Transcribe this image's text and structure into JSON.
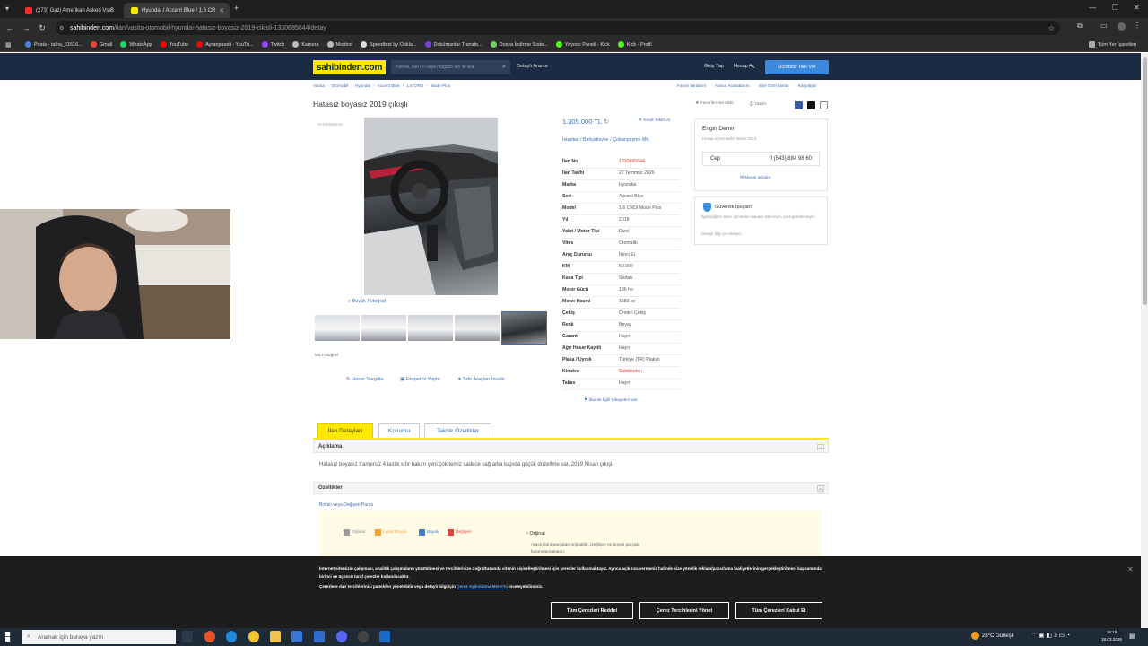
{
  "browser": {
    "tabs": [
      {
        "title": "(273) Gazi Amerikan Askeri Vs B",
        "active": false
      },
      {
        "title": "Hyundai / Accent Blue / 1.6 CR",
        "active": true
      }
    ],
    "url_host": "sahibinden.com",
    "url_path": "/ilan/vasita-otomobil-hyundai-hatasiz-boyasiz-2019-cikisli-1330685644/detay",
    "bookmarks": [
      "Posta - talha_61616...",
      "Gmail",
      "WhatsApp",
      "YouTube",
      "Ayranpaseli - YouTu...",
      "Twitch",
      "Kamera",
      "Moobot",
      "Speedtest by Ookla...",
      "Dokümanlar Transfe...",
      "Dosya İndirme Sıste...",
      "Yayıncı Paneli - Kick",
      "Kick - Profil"
    ],
    "all_bookmarks": "Tüm Yer İşaretleri"
  },
  "site": {
    "logo": "sahibinden.com",
    "search_placeholder": "Kelime, ilan no veya mağaza adı ile ara",
    "detailed_search": "Detaylı Arama",
    "login": "Giriş Yap",
    "register": "Hesap Aç",
    "post_button": "Ücretsiz* İlan Ver"
  },
  "breadcrumbs": [
    "Vasıta",
    "Otomobil",
    "Hyundai",
    "Accent Blue",
    "1.6 CRDI",
    "Mode Plus"
  ],
  "right_links": [
    "Favori İlanlarım",
    "Favori Aramalarım",
    "Size Özel İlanlar",
    "Karşılaştır"
  ],
  "listing": {
    "title": "Hatasız boyasız 2019 çıkışlı",
    "small_no": "#1330685644",
    "actions": [
      "Favorilerime Ekle",
      "Yazdır"
    ],
    "big_photo": "Büyük Fotoğraf",
    "photo_count": "5/5 Fotoğraf",
    "tools": [
      "Hasar Sorgula",
      "Ekspertiz Yaptır",
      "Sıfır Araçları İncele"
    ],
    "price": "1.305.000 TL",
    "credit": "Kredi Teklifi Al",
    "location": "İstanbul  /  Bahçelievler  /  Çobançeşme Mh.",
    "details": [
      {
        "label": "İlan No",
        "value": "1330685644",
        "red": true
      },
      {
        "label": "İlan Tarihi",
        "value": "27 Temmuz 2026"
      },
      {
        "label": "Marka",
        "value": "Hyundai"
      },
      {
        "label": "Seri",
        "value": "Accent Blue"
      },
      {
        "label": "Model",
        "value": "1.6 CRDI Mode Plus"
      },
      {
        "label": "Yıl",
        "value": "2018"
      },
      {
        "label": "Yakıt / Motor Tipi",
        "value": "Dizel"
      },
      {
        "label": "Vites",
        "value": "Otomatik"
      },
      {
        "label": "Araç Durumu",
        "value": "İkinci El"
      },
      {
        "label": "KM",
        "value": "50.000"
      },
      {
        "label": "Kasa Tipi",
        "value": "Sedan"
      },
      {
        "label": "Motor Gücü",
        "value": "136 hp"
      },
      {
        "label": "Motor Hacmi",
        "value": "1582 cc"
      },
      {
        "label": "Çekiş",
        "value": "Önden Çekiş"
      },
      {
        "label": "Renk",
        "value": "Beyaz"
      },
      {
        "label": "Garanti",
        "value": "Hayır"
      },
      {
        "label": "Ağır Hasar Kayıtlı",
        "value": "Hayır"
      },
      {
        "label": "Plaka / Uyruk",
        "value": "Türkiye (TR) Plakalı"
      },
      {
        "label": "Kimden",
        "value": "Sahibinden",
        "red": true
      },
      {
        "label": "Takas",
        "value": "Hayır"
      }
    ],
    "report": "İlan ile İlgili Şikayetim Var"
  },
  "seller": {
    "name": "Engin Demir",
    "since": "Hesap açma tarihi: Nisan 2023",
    "phone_label": "Cep",
    "phone": "0 (543) 884 98 60",
    "message": "Mesaj gönder",
    "safety_title": "Güvenlik İpuçları",
    "safety_text": "İlgilendiğiniz aracı görmeden kaparo ödemeyin, para göndermeyin.",
    "safety_more": "Detaylı bilgi için tıklayın."
  },
  "page_tabs": [
    "İlan Detayları",
    "Konumu",
    "Teknik Özellikler"
  ],
  "description": {
    "heading": "Açıklama",
    "text": "Hatasız boyasız tramersiz 4 lastik sıfır bakım yeni çok temiz sadece sağ arka kapıda göçük düzeltme var. 2019 Nisan çıkışlı"
  },
  "features": {
    "heading": "Özellikler",
    "sub": "Boyalı veya Değişen Parça",
    "legend": [
      {
        "label": "Orijinal",
        "color": "#9b9b9b"
      },
      {
        "label": "Lokal Boyalı",
        "color": "#f5a13a"
      },
      {
        "label": "Boyalı",
        "color": "#3d7fd1"
      },
      {
        "label": "Değişen",
        "color": "#e0453a"
      }
    ],
    "orig_title": "Orijinal",
    "orig_text": "Aracın tüm parçaları orijinaldir. Değişen ve boyalı parçası bulunmamaktadır."
  },
  "cookie": {
    "text1": "İnternet sitemizin çalışması, analitik çalışmaların yürütülmesi ve tercihlerinize doğrultusunda sitenin kişiselleştirilmesi için çerezler kullanmaktayız. Ayrıca açık rıza vermeniz halinde size yönelik reklam/pazarlama faaliyetlerinin gerçekleştirilmesi kapsamında birinci ve üçüncü taraf çerezler kullanılacaktır.",
    "text2_pre": "Çerezlere dair tercihlerinizi panelden yönetebilir veya detaylı bilgi için",
    "text2_link": "Çerez Aydınlatma Metni'ni",
    "text2_post": "inceleyebilirsiniz.",
    "reject": "Tüm Çerezleri Reddet",
    "manage": "Çerez Tercihlerini Yönet",
    "accept": "Tüm Çerezleri Kabul Et"
  },
  "taskbar": {
    "search": "Aramak için buraya yazın",
    "weather": "28°C  Güneşli",
    "time": "16:15",
    "date": "18.03.2026"
  }
}
